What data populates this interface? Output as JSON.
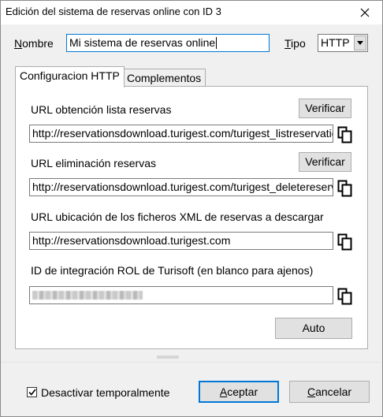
{
  "window": {
    "title": "Edición del sistema de reservas online con ID 3"
  },
  "form": {
    "name_label_underlined": "N",
    "name_label_rest": "ombre",
    "name_value": "Mi sistema de reservas online",
    "type_label_underlined": "T",
    "type_label_rest": "ipo",
    "type_value": "HTTP"
  },
  "tabs": [
    {
      "label": "Configuracion HTTP",
      "active": true
    },
    {
      "label": "Complementos",
      "active": false
    }
  ],
  "http_config": {
    "list_label": "URL obtención lista reservas",
    "list_verify": "Verificar",
    "list_url": "http://reservationsdownload.turigest.com/turigest_listreservations",
    "delete_label": "URL eliminación reservas",
    "delete_verify": "Verificar",
    "delete_url": "http://reservationsdownload.turigest.com/turigest_deletereservati",
    "xml_label": "URL ubicación de los ficheros XML de reservas a descargar",
    "xml_url": "http://reservationsdownload.turigest.com",
    "rol_label": "ID de integración ROL de Turisoft (en blanco para ajenos)",
    "auto_button": "Auto"
  },
  "footer": {
    "disable_checked": true,
    "disable_label": "Desactivar temporalmente",
    "accept_underlined": "A",
    "accept_rest": "ceptar",
    "cancel_underlined": "C",
    "cancel_rest": "ancelar"
  },
  "icons": {
    "close": "close-icon",
    "dropdown": "chevron-down-icon",
    "copy": "copy-icon",
    "check": "check-icon"
  }
}
